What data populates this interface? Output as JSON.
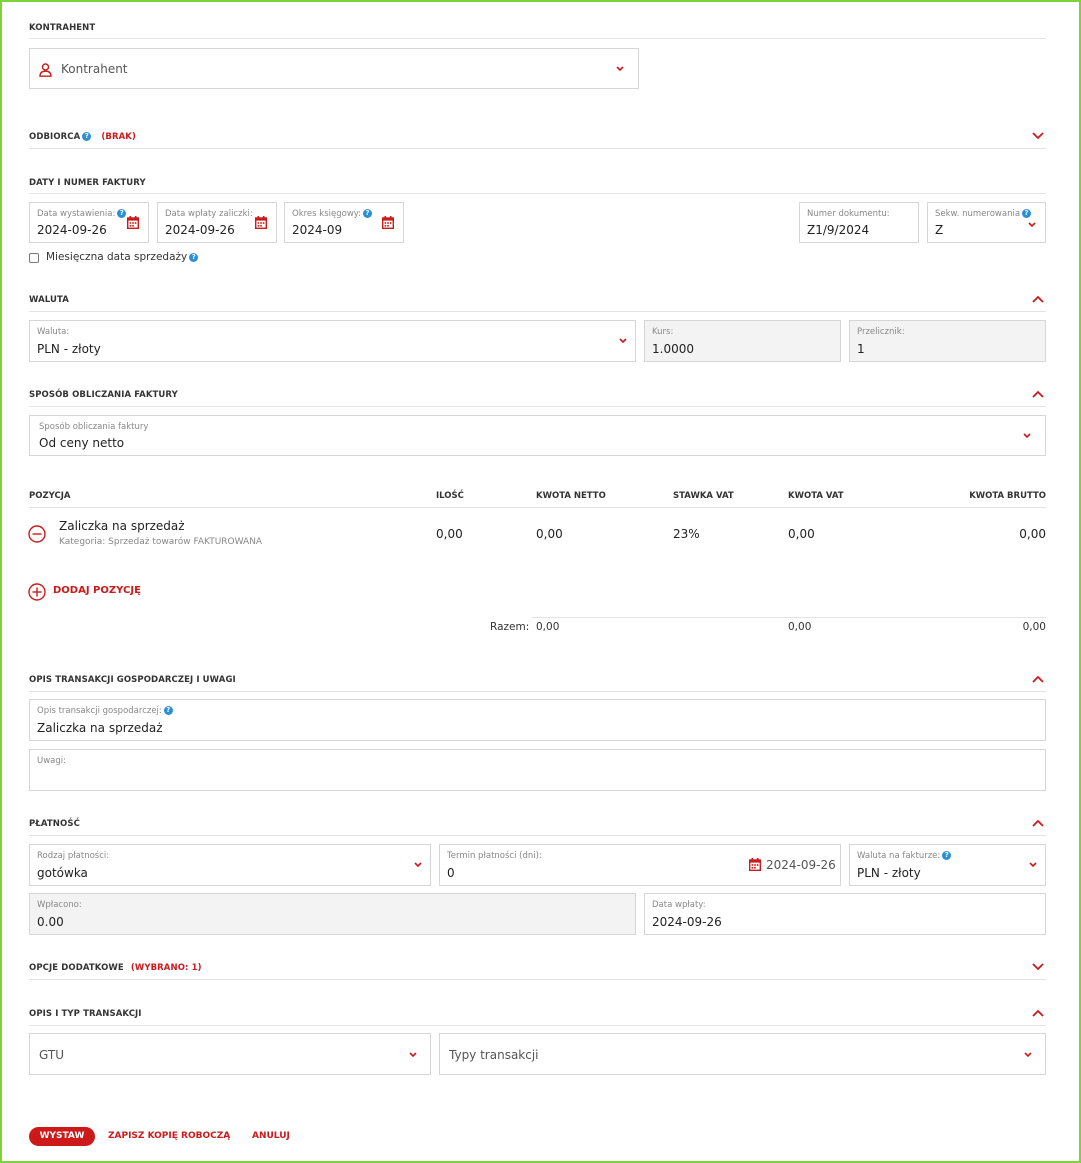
{
  "kontrahent": {
    "title": "KONTRAHENT",
    "placeholder": "Kontrahent"
  },
  "odbiorca": {
    "title": "ODBIORCA",
    "status": "(BRAK)"
  },
  "daty": {
    "title": "DATY I NUMER FAKTURY",
    "data_wystawienia": {
      "label": "Data wystawienia:",
      "value": "2024-09-26"
    },
    "data_wplaty_zaliczki": {
      "label": "Data wpłaty zaliczki:",
      "value": "2024-09-26"
    },
    "okres_ksiegowy": {
      "label": "Okres księgowy:",
      "value": "2024-09"
    },
    "numer_dokumentu": {
      "label": "Numer dokumentu:",
      "value": "Z1/9/2024"
    },
    "sekw_numerowania": {
      "label": "Sekw. numerowania",
      "value": "Z"
    },
    "miesieczna_label": "Miesięczna data sprzedaży"
  },
  "waluta": {
    "title": "WALUTA",
    "waluta": {
      "label": "Waluta:",
      "value": "PLN - złoty"
    },
    "kurs": {
      "label": "Kurs:",
      "value": "1.0000"
    },
    "przelicznik": {
      "label": "Przelicznik:",
      "value": "1"
    }
  },
  "sposob": {
    "title": "SPOSÓB OBLICZANIA FAKTURY",
    "label": "Sposób obliczania faktury",
    "value": "Od ceny netto"
  },
  "pozycje": {
    "headers": {
      "pozycja": "POZYCJA",
      "ilosc": "ILOŚĆ",
      "kwota_netto": "KWOTA NETTO",
      "stawka_vat": "STAWKA VAT",
      "kwota_vat": "KWOTA VAT",
      "kwota_brutto": "KWOTA BRUTTO"
    },
    "rows": [
      {
        "name": "Zaliczka na sprzedaż",
        "category": "Kategoria: Sprzedaż towarów FAKTUROWANA",
        "ilosc": "0,00",
        "kwota_netto": "0,00",
        "stawka_vat": "23%",
        "kwota_vat": "0,00",
        "kwota_brutto": "0,00"
      }
    ],
    "add_label": "DODAJ POZYCJĘ",
    "razem": {
      "label": "Razem:",
      "netto": "0,00",
      "vat": "0,00",
      "brutto": "0,00"
    }
  },
  "opis": {
    "title": "OPIS TRANSAKCJI GOSPODARCZEJ I UWAGI",
    "opis_transakcji": {
      "label": "Opis transakcji gospodarczej:",
      "value": "Zaliczka na sprzedaż"
    },
    "uwagi": {
      "label": "Uwagi:",
      "value": ""
    }
  },
  "platnosc": {
    "title": "PŁATNOŚĆ",
    "rodzaj": {
      "label": "Rodzaj płatności:",
      "value": "gotówka"
    },
    "termin": {
      "label": "Termin płatności (dni):",
      "value": "0",
      "date": "2024-09-26"
    },
    "waluta_na_fakturze": {
      "label": "Waluta na fakturze:",
      "value": "PLN - złoty"
    },
    "wplacono": {
      "label": "Wpłacono:",
      "value": "0.00"
    },
    "data_wplaty": {
      "label": "Data wpłaty:",
      "value": "2024-09-26"
    }
  },
  "opcje": {
    "title": "OPCJE DODATKOWE",
    "status": "(WYBRANO: 1)"
  },
  "opis_typ": {
    "title": "OPIS I TYP TRANSAKCJI",
    "gtu_placeholder": "GTU",
    "typy_placeholder": "Typy transakcji"
  },
  "actions": {
    "wystaw": "WYSTAW",
    "zapisz": "ZAPISZ KOPIĘ ROBOCZĄ",
    "anuluj": "ANULUJ"
  },
  "colors": {
    "accent": "#cc1a1a",
    "help": "#2b8fd6",
    "frame": "#7fd23a"
  },
  "icons": [
    "user-icon",
    "chevron-down-icon",
    "chevron-up-icon",
    "calendar-icon",
    "help-icon",
    "minus-circle-icon",
    "plus-circle-icon"
  ]
}
